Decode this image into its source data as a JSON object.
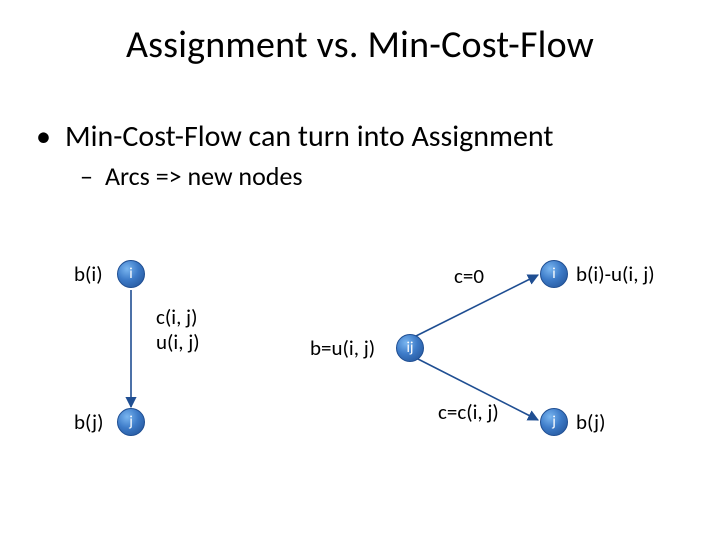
{
  "title": "Assignment vs. Min-Cost-Flow",
  "bullets": {
    "b1": "Min-Cost-Flow can turn into Assignment",
    "b2": "Arcs  =>  new nodes"
  },
  "left_graph": {
    "node_i": {
      "label": "i",
      "annotation": "b(i)"
    },
    "node_j": {
      "label": "j",
      "annotation": "b(j)"
    },
    "arc": {
      "cost": "c(i, j)",
      "cap": "u(i, j)"
    }
  },
  "right_graph": {
    "node_i": {
      "label": "i",
      "annotation": "b(i)-u(i, j)"
    },
    "node_ij": {
      "label": "ij",
      "annotation": "b=u(i, j)"
    },
    "node_j": {
      "label": "j",
      "annotation": "b(j)"
    },
    "arc_i_ij": {
      "label": "c=0"
    },
    "arc_ij_j": {
      "label": "c=c(i, j)"
    }
  }
}
